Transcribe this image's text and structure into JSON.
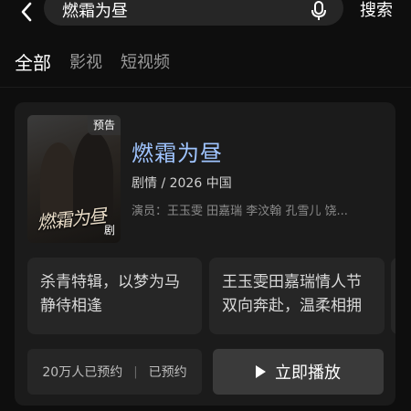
{
  "header": {
    "back_icon": "chevron-left-icon",
    "search_value": "燃霜为昼",
    "mic_icon": "microphone-icon",
    "search_label": "搜索"
  },
  "tabs": [
    {
      "label": "全部",
      "active": true
    },
    {
      "label": "影视",
      "active": false
    },
    {
      "label": "短视频",
      "active": false
    }
  ],
  "result": {
    "poster_tag": "预告",
    "poster_calligraphy": "燃霜为昼",
    "poster_genre": "剧",
    "title": "燃霜为昼",
    "meta": "剧情 / 2026 中国",
    "cast": "演员：王玉雯 田嘉瑞 李汶翰 孔雪儿 饶...",
    "highlights": [
      {
        "text": "杀青特辑，以梦为马静待相逢"
      },
      {
        "text": "王玉雯田嘉瑞情人节双向奔赴，温柔相拥"
      }
    ],
    "reserve_count": "20万人已预约",
    "reserve_status": "已预约",
    "play_label": "立即播放"
  },
  "colors": {
    "title": "#9fc4ff",
    "background": "#0e0e0e",
    "card": "#1b1b1b"
  }
}
